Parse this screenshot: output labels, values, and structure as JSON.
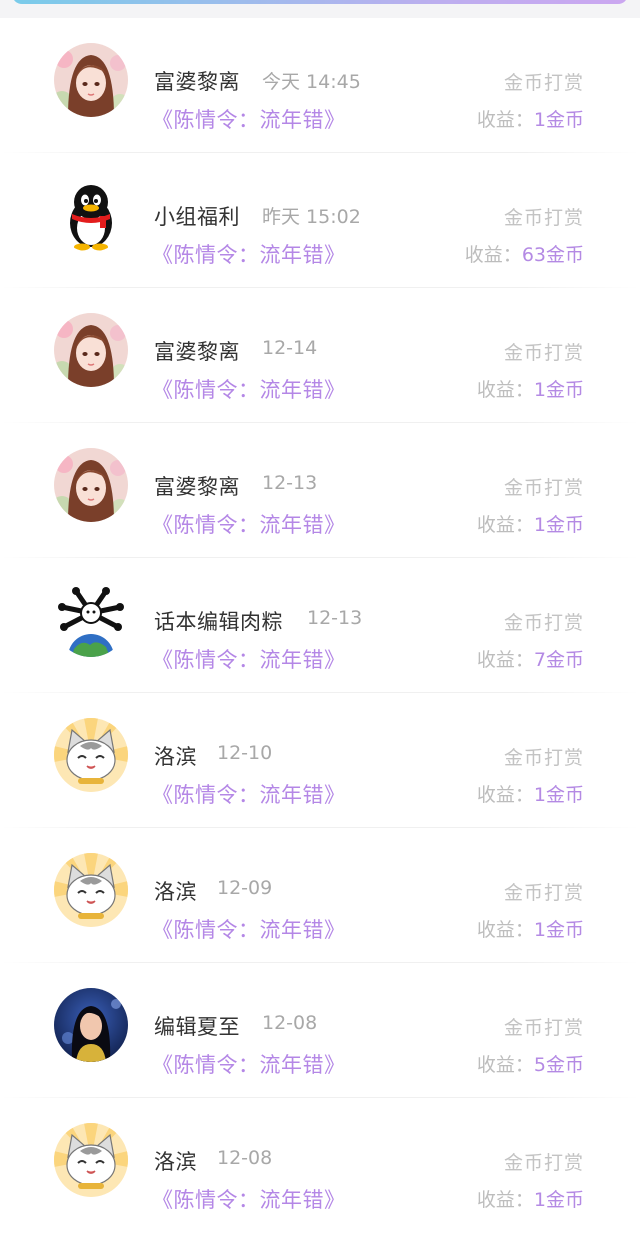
{
  "header": {},
  "rows": [
    {
      "name": "富婆黎离",
      "time": "今天 14:45",
      "work": "《陈情令：流年错》",
      "type": "金币打赏",
      "earn_label": "收益：",
      "earn_value": "1金币",
      "avatar": "anime-girl-avatar"
    },
    {
      "name": "小组福利",
      "time": "昨天 15:02",
      "work": "《陈情令：流年错》",
      "type": "金币打赏",
      "earn_label": "收益：",
      "earn_value": "63金币",
      "avatar": "penguin-avatar"
    },
    {
      "name": "富婆黎离",
      "time": "12-14",
      "work": "《陈情令：流年错》",
      "type": "金币打赏",
      "earn_label": "收益：",
      "earn_value": "1金币",
      "avatar": "anime-girl-avatar"
    },
    {
      "name": "富婆黎离",
      "time": "12-13",
      "work": "《陈情令：流年错》",
      "type": "金币打赏",
      "earn_label": "收益：",
      "earn_value": "1金币",
      "avatar": "anime-girl-avatar"
    },
    {
      "name": "话本编辑肉粽",
      "time": "12-13",
      "work": "《陈情令：流年错》",
      "type": "金币打赏",
      "earn_label": "收益：",
      "earn_value": "7金币",
      "avatar": "earth-creature-avatar"
    },
    {
      "name": "洛滨",
      "time": "12-10",
      "work": "《陈情令：流年错》",
      "type": "金币打赏",
      "earn_label": "收益：",
      "earn_value": "1金币",
      "avatar": "cartoon-cat-avatar"
    },
    {
      "name": "洛滨",
      "time": "12-09",
      "work": "《陈情令：流年错》",
      "type": "金币打赏",
      "earn_label": "收益：",
      "earn_value": "1金币",
      "avatar": "cartoon-cat-avatar"
    },
    {
      "name": "编辑夏至",
      "time": "12-08",
      "work": "《陈情令：流年错》",
      "type": "金币打赏",
      "earn_label": "收益：",
      "earn_value": "5金币",
      "avatar": "photo-woman-avatar"
    },
    {
      "name": "洛滨",
      "time": "12-08",
      "work": "《陈情令：流年错》",
      "type": "金币打赏",
      "earn_label": "收益：",
      "earn_value": "1金币",
      "avatar": "cartoon-cat-avatar"
    }
  ],
  "colors": {
    "accent": "#b487e6",
    "name": "#333333",
    "muted": "#a8a8a8"
  }
}
